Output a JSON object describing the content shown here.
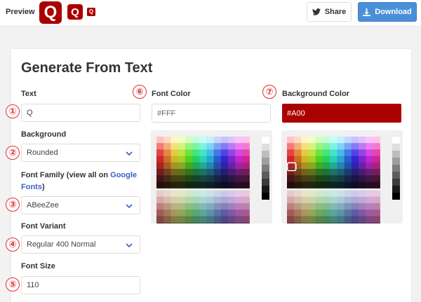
{
  "header": {
    "preview_label": "Preview",
    "favicon_letter": "Q",
    "share_label": "Share",
    "download_label": "Download"
  },
  "colors": {
    "favicon_bg": "#AA0000",
    "favicon_fg": "#FFFFFF",
    "download_bg": "#4a90d9",
    "badge": "#e03030"
  },
  "card": {
    "title": "Generate From Text"
  },
  "badges": [
    "①",
    "②",
    "③",
    "④",
    "⑤",
    "⑥",
    "⑦"
  ],
  "form": {
    "text": {
      "label": "Text",
      "value": "Q"
    },
    "background": {
      "label": "Background",
      "value": "Rounded"
    },
    "font_family": {
      "label_prefix": "Font Family (view all on ",
      "link_text": "Google Fonts",
      "label_suffix": ")",
      "value": "ABeeZee"
    },
    "font_variant": {
      "label": "Font Variant",
      "value": "Regular 400 Normal"
    },
    "font_size": {
      "label": "Font Size",
      "value": "110"
    },
    "font_color": {
      "label": "Font Color",
      "value": "#FFF"
    },
    "background_color": {
      "label": "Background Color",
      "value": "#A00"
    }
  }
}
